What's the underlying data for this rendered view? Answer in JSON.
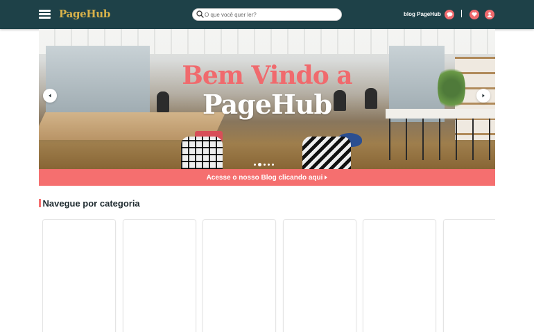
{
  "header": {
    "logo": "PageHub",
    "search": {
      "placeholder": "O que você quer ler?",
      "value": ""
    },
    "blog_label": "blog PageHub",
    "separator": "|",
    "icons": [
      "menu-icon",
      "search-icon",
      "chat-icon",
      "heart-icon",
      "user-icon"
    ]
  },
  "hero": {
    "title_line1": "Bem Vindo a",
    "title_line2": "PageHub",
    "slide_count": 5,
    "active_slide": 1
  },
  "banner": {
    "label": "Acesse o nosso Blog clicando aqui"
  },
  "categories": {
    "title": "Navegue por categoria",
    "card_count": 6
  },
  "colors": {
    "header_bg": "#1e4148",
    "logo": "#d9b24a",
    "accent": "#f56f6f",
    "hero_title_accent": "#f06a6d"
  }
}
